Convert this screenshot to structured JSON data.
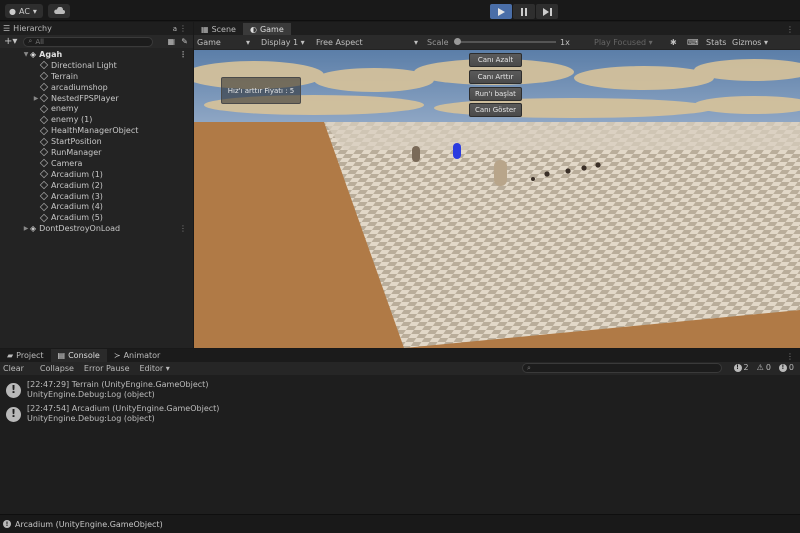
{
  "toolbar": {
    "account_label": "AC",
    "play_buttons": [
      "play",
      "pause",
      "step"
    ]
  },
  "hierarchy": {
    "tab_label": "Hierarchy",
    "search_placeholder": "All",
    "scene_name": "Agah",
    "items": [
      {
        "label": "Directional Light",
        "has_children": false
      },
      {
        "label": "Terrain",
        "has_children": false
      },
      {
        "label": "arcadiumshop",
        "has_children": false
      },
      {
        "label": "NestedFPSPlayer",
        "has_children": true
      },
      {
        "label": "enemy",
        "has_children": false
      },
      {
        "label": "enemy (1)",
        "has_children": false
      },
      {
        "label": "HealthManagerObject",
        "has_children": false
      },
      {
        "label": "StartPosition",
        "has_children": false
      },
      {
        "label": "RunManager",
        "has_children": false
      },
      {
        "label": "Camera",
        "has_children": false
      },
      {
        "label": "Arcadium (1)",
        "has_children": false
      },
      {
        "label": "Arcadium (2)",
        "has_children": false
      },
      {
        "label": "Arcadium (3)",
        "has_children": false
      },
      {
        "label": "Arcadium (4)",
        "has_children": false
      },
      {
        "label": "Arcadium (5)",
        "has_children": false
      }
    ],
    "dont_destroy": "DontDestroyOnLoad"
  },
  "game": {
    "tabs": [
      "Scene",
      "Game"
    ],
    "mode": "Game",
    "display": "Display 1",
    "aspect": "Free Aspect",
    "scale_label": "Scale",
    "scale_value": "1x",
    "play_focused": "Play Focused",
    "stats": "Stats",
    "gizmos": "Gizmos",
    "ui": {
      "speed_price": "Hız'ı arttır Fiyatı : 5",
      "buttons": [
        "Canı Azalt",
        "Canı Arttır",
        "Run'ı başlat",
        "Canı Göster"
      ]
    }
  },
  "console": {
    "tabs": [
      "Project",
      "Console",
      "Animator"
    ],
    "clear": "Clear",
    "collapse": "Collapse",
    "error_pause": "Error Pause",
    "editor": "Editor",
    "counts": {
      "log": "2",
      "warn": "0",
      "error": "0"
    },
    "logs": [
      {
        "line1": "[22:47:29] Terrain (UnityEngine.GameObject)",
        "line2": "UnityEngine.Debug:Log (object)"
      },
      {
        "line1": "[22:47:54] Arcadium (UnityEngine.GameObject)",
        "line2": "UnityEngine.Debug:Log (object)"
      }
    ]
  },
  "status": {
    "message": "Arcadium (UnityEngine.GameObject)"
  }
}
